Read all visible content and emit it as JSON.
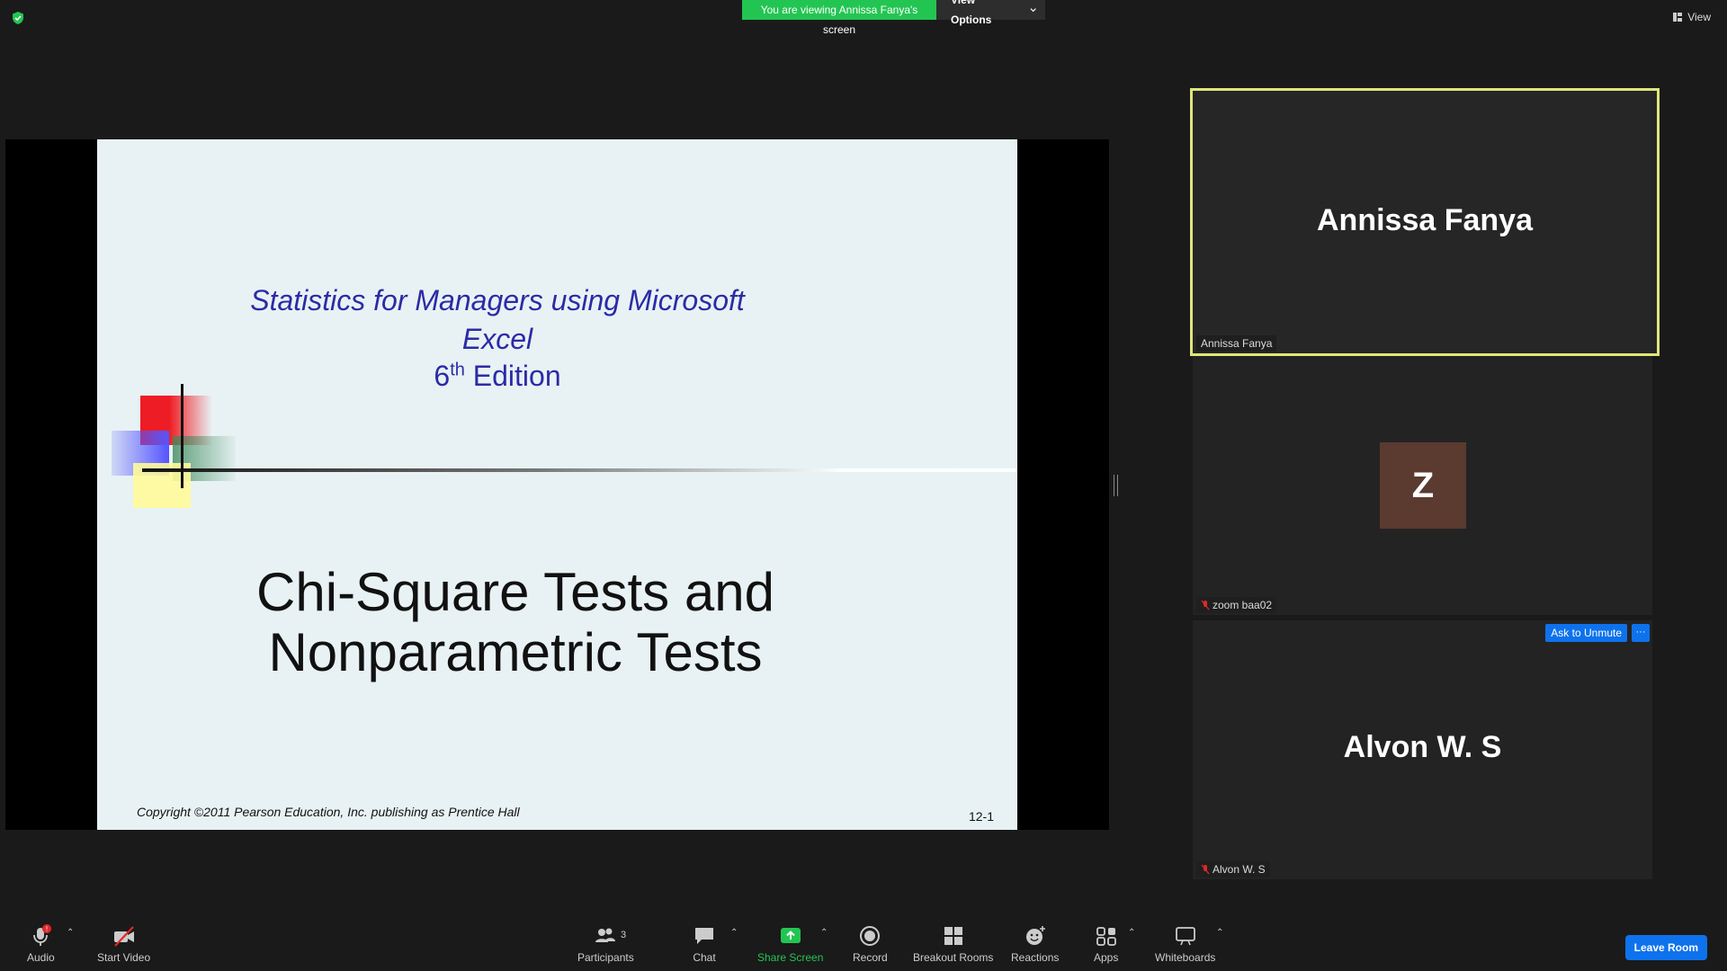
{
  "banner": {
    "text": "You are viewing Annissa Fanya's screen",
    "view_options": "View Options"
  },
  "top_right": {
    "view_label": "View"
  },
  "slide": {
    "subtitle_line1": "Statistics for Managers using Microsoft",
    "subtitle_line2": "Excel",
    "edition_num": "6",
    "edition_sup": "th",
    "edition_word": "Edition",
    "title_line1": "Chi-Square Tests and",
    "title_line2": "Nonparametric Tests",
    "copyright": "Copyright ©2011 Pearson Education, Inc. publishing as Prentice Hall",
    "page": "12-1"
  },
  "participants": [
    {
      "display": "Annissa Fanya",
      "label": "Annissa Fanya"
    },
    {
      "avatar": "Z",
      "label": "zoom baa02"
    },
    {
      "display": "Alvon W. S",
      "label": "Alvon W. S",
      "ask": "Ask to Unmute",
      "more": "···"
    }
  ],
  "toolbar": {
    "audio": "Audio",
    "audio_badge": "!",
    "video": "Start Video",
    "participants": "Participants",
    "participants_count": "3",
    "chat": "Chat",
    "share": "Share Screen",
    "record": "Record",
    "breakout": "Breakout Rooms",
    "reactions": "Reactions",
    "apps": "Apps",
    "whiteboards": "Whiteboards",
    "leave": "Leave Room"
  },
  "colors": {
    "share_green": "#23c552",
    "zoom_blue": "#0e72ed",
    "active_border": "#dfe67a"
  }
}
